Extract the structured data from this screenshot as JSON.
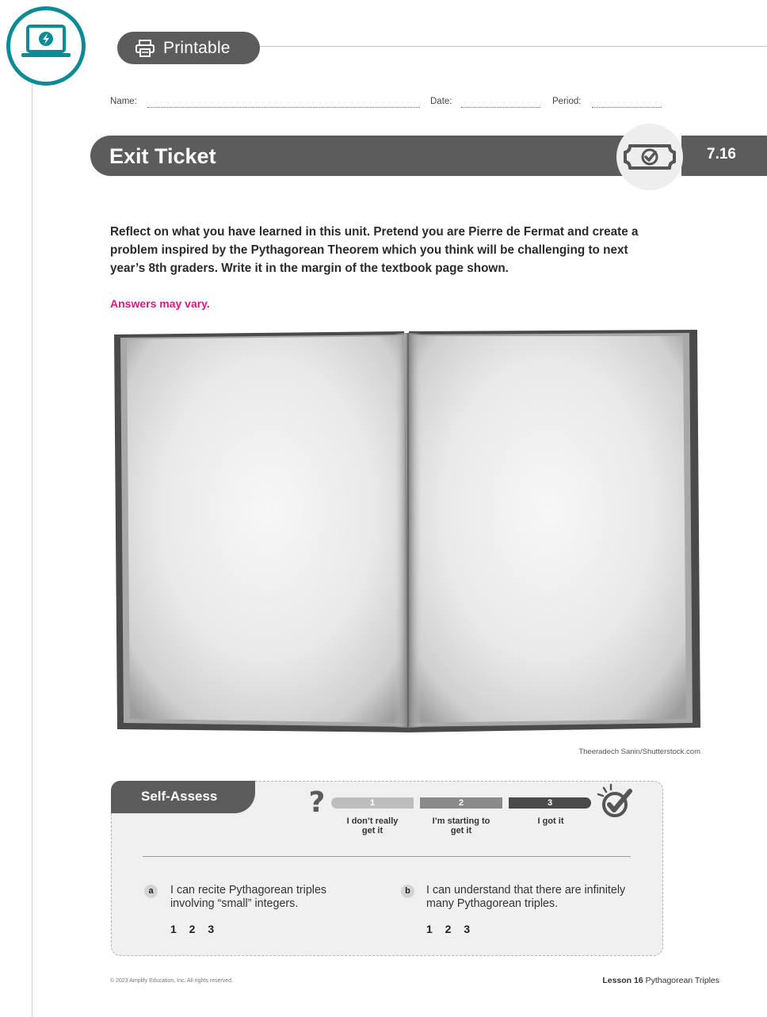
{
  "header": {
    "printable_label": "Printable"
  },
  "fields": {
    "name_label": "Name:",
    "date_label": "Date:",
    "period_label": "Period:"
  },
  "exit_ticket": {
    "title": "Exit Ticket",
    "lesson_number": "7.16"
  },
  "prompt": {
    "text": "Reflect on what you have learned in this unit. Pretend you are Pierre de Fermat and create a problem inspired by the Pythagorean Theorem which you think will be challenging to next year’s 8th graders. Write it in the margin of the textbook page shown.",
    "answer_note": "Answers may vary."
  },
  "image": {
    "credit": "Theeradech Sanin/Shutterstock.com"
  },
  "self_assess": {
    "title": "Self-Assess",
    "scale": [
      {
        "number": "1",
        "label": "I don’t really get it",
        "color": "#bdbdbd"
      },
      {
        "number": "2",
        "label": "I’m starting to get it",
        "color": "#8a8a8a"
      },
      {
        "number": "3",
        "label": "I got it",
        "color": "#4a4a4a"
      }
    ],
    "items": [
      {
        "letter": "a",
        "text": "I can recite Pythagorean triples involving “small” integers.",
        "rating": "1 2 3"
      },
      {
        "letter": "b",
        "text": "I can understand that there are infinitely many Pythagorean triples.",
        "rating": "1 2 3"
      }
    ]
  },
  "footer": {
    "copyright": "© 2023 Amplify Education, Inc. All rights reserved.",
    "lesson": "Lesson 16",
    "lesson_title": "Pythagorean Triples"
  },
  "colors": {
    "teal": "#0b8b96",
    "dark_gray": "#5c5c5c",
    "magenta": "#e0167f"
  }
}
